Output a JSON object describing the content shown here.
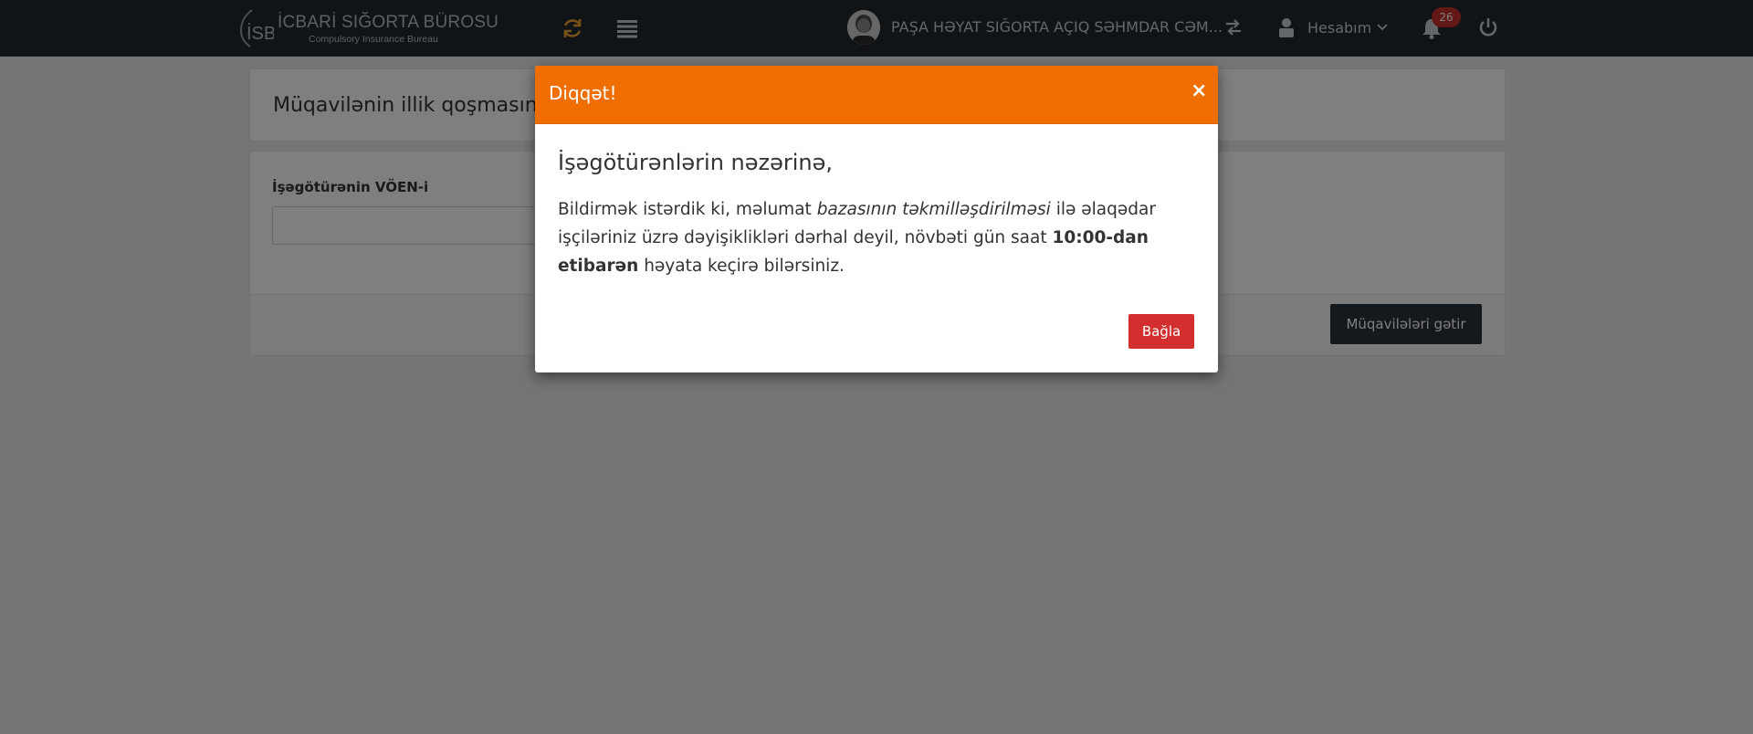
{
  "navbar": {
    "logo_title": "İCBARİ SIĞORTA BÜROSU",
    "logo_subtitle": "Compulsory Insurance Bureau",
    "company_name": "PAŞA HƏYAT SIĞORTA AÇIQ SƏHMDAR CƏM...",
    "account_label": "Hesabım",
    "notification_count": "26",
    "icons": [
      "refresh-icon",
      "menu-icon",
      "avatar",
      "switch-icon",
      "user-icon",
      "chevron-down-icon",
      "bell-icon",
      "power-icon"
    ],
    "accent_color": "#f0a030"
  },
  "page": {
    "title": "Müqavilənin illik qoşmasında",
    "form_label": "İşəgötürənin VÖEN-i",
    "input_value": "",
    "fetch_button": "Müqavilələri gətir"
  },
  "modal": {
    "title": "Diqqət!",
    "close_symbol": "×",
    "heading": "İşəgötürənlərin nəzərinə,",
    "text_part1": "Bildirmək istərdik ki, məlumat ",
    "text_italic": "bazasının təkmilləşdirilməsi",
    "text_part2": " ilə əlaqədar işçiləriniz üzrə dəyişiklikləri dərhal deyil, növbəti gün saat ",
    "text_bold": "10:00-dan etibarən",
    "text_part3": " həyata keçirə bilərsiniz.",
    "close_button": "Bağla",
    "header_color": "#f06e00",
    "button_color": "#d32f2f"
  }
}
